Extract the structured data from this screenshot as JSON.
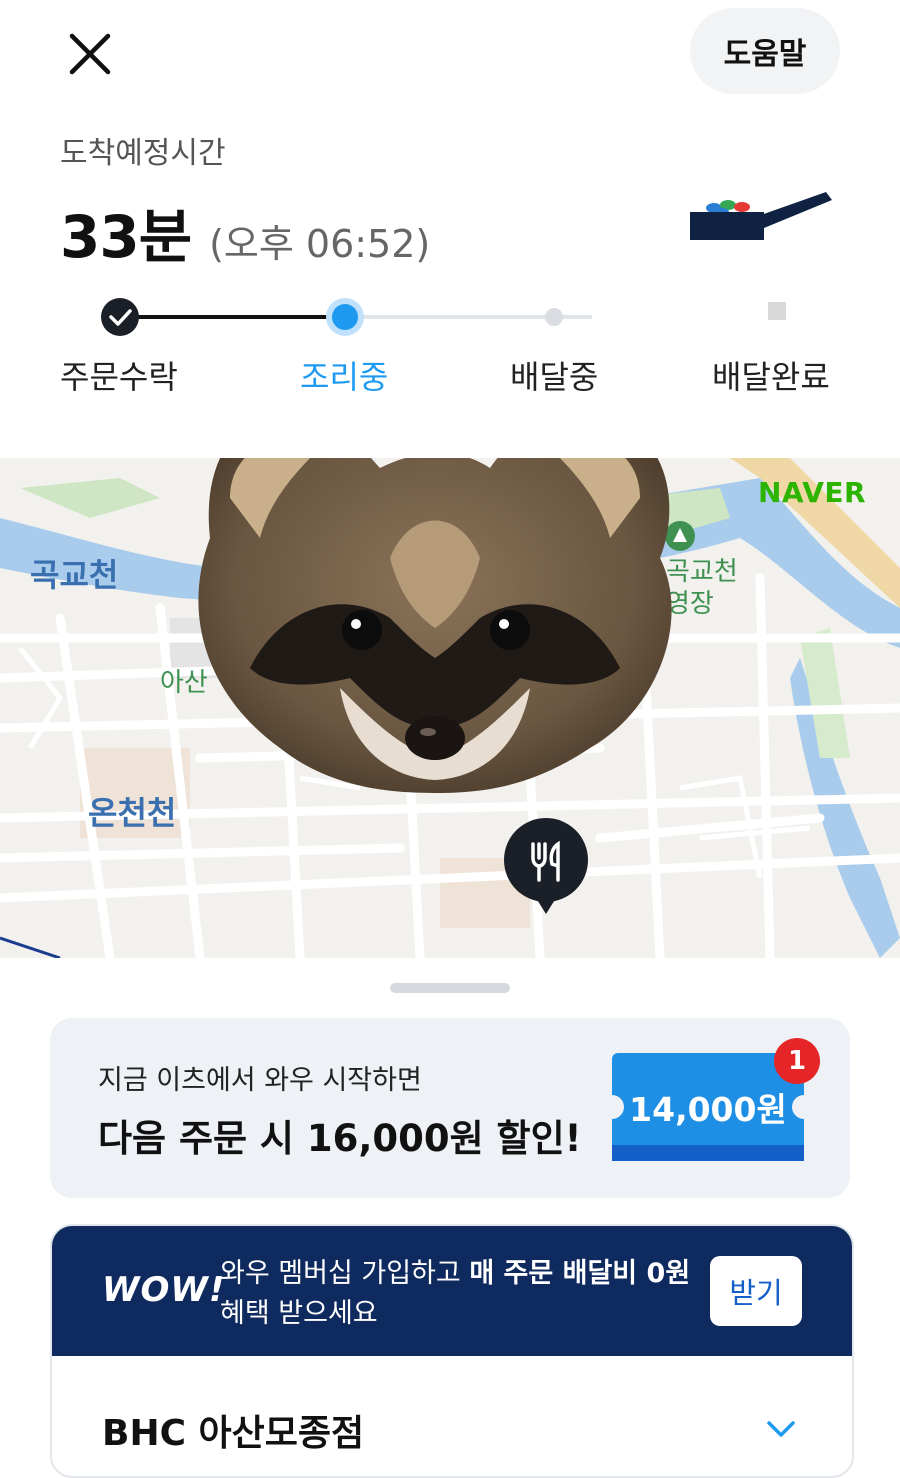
{
  "header": {
    "help_label": "도움말"
  },
  "eta": {
    "label": "도착예정시간",
    "minutes_text": "33분",
    "clock_text": "(오후 06:52)"
  },
  "progress": {
    "steps": [
      {
        "label": "주문수락",
        "state": "done"
      },
      {
        "label": "조리중",
        "state": "active"
      },
      {
        "label": "배달중",
        "state": "pending"
      },
      {
        "label": "배달완료",
        "state": "pending"
      }
    ]
  },
  "map": {
    "labels": {
      "gokgyocheon": "곡교천",
      "gokgyocheon_venue": "곡교천\n영장",
      "asan": "아산",
      "oncheoncheon": "온천천"
    },
    "logo": "NAVER",
    "pin_icon": "restaurant-pin-icon"
  },
  "promo": {
    "subtitle": "지금 이츠에서 와우 시작하면",
    "title": "다음 주문 시 16,000원 할인!",
    "coupon_amount": "14,000원",
    "coupon_count": "1"
  },
  "wow": {
    "logo": "WOW!",
    "text_normal": "와우 멤버십 가입하고 ",
    "text_bold": "매 주문 배달비 0원",
    "text_line2": "혜택 받으세요",
    "button_label": "받기"
  },
  "store": {
    "name": "BHC 아산모종점"
  },
  "colors": {
    "accent": "#1e9bf0",
    "wow_band": "#0f2a5e",
    "badge": "#e52528",
    "coupon": "#1f8fe6"
  }
}
